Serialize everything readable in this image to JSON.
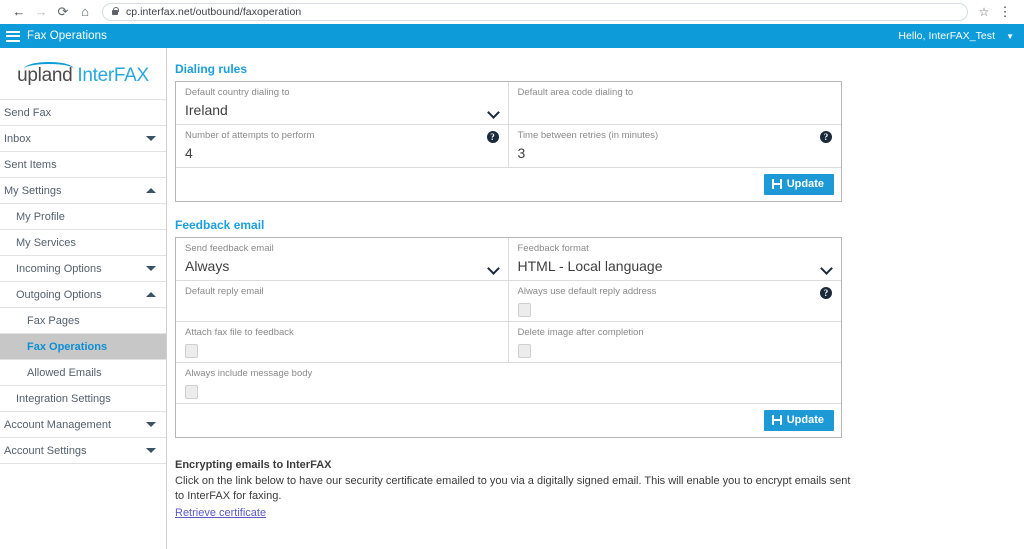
{
  "browser": {
    "back_icon": "back-arrow-icon",
    "forward_icon": "forward-arrow-icon",
    "reload_glyph": "⟳",
    "home_glyph": "⌂",
    "lock_icon": "lock-icon",
    "url": "cp.interfax.net/outbound/faxoperation",
    "star_glyph": "☆",
    "menu_glyph": "⋮"
  },
  "header": {
    "menu_icon": "hamburger-menu-icon",
    "title": "Fax Operations",
    "user_greeting": "Hello, InterFAX_Test",
    "caret_glyph": "▼"
  },
  "logo": {
    "upland": "upland",
    "interfax": "InterFAX"
  },
  "sidebar": {
    "items": [
      {
        "label": "Send Fax",
        "level": 1,
        "caret": "none",
        "active": false
      },
      {
        "label": "Inbox",
        "level": 1,
        "caret": "down",
        "active": false
      },
      {
        "label": "Sent Items",
        "level": 1,
        "caret": "none",
        "active": false
      },
      {
        "label": "My Settings",
        "level": 1,
        "caret": "up",
        "active": false
      },
      {
        "label": "My Profile",
        "level": 2,
        "caret": "none",
        "active": false
      },
      {
        "label": "My Services",
        "level": 2,
        "caret": "none",
        "active": false
      },
      {
        "label": "Incoming Options",
        "level": 2,
        "caret": "down",
        "active": false
      },
      {
        "label": "Outgoing Options",
        "level": 2,
        "caret": "up",
        "active": false
      },
      {
        "label": "Fax Pages",
        "level": 3,
        "caret": "none",
        "active": false
      },
      {
        "label": "Fax Operations",
        "level": 3,
        "caret": "none",
        "active": true
      },
      {
        "label": "Allowed Emails",
        "level": 3,
        "caret": "none",
        "active": false
      },
      {
        "label": "Integration Settings",
        "level": 2,
        "caret": "none",
        "active": false
      },
      {
        "label": "Account Management",
        "level": 1,
        "caret": "down",
        "active": false
      },
      {
        "label": "Account Settings",
        "level": 1,
        "caret": "down",
        "active": false
      }
    ]
  },
  "dialing_rules": {
    "title": "Dialing rules",
    "country_label": "Default country dialing to",
    "country_value": "Ireland",
    "area_code_label": "Default area code dialing to",
    "area_code_value": "",
    "attempts_label": "Number of attempts to perform",
    "attempts_value": "4",
    "retry_label": "Time between retries (in minutes)",
    "retry_value": "3",
    "update_label": "Update"
  },
  "feedback_email": {
    "title": "Feedback email",
    "send_label": "Send feedback email",
    "send_value": "Always",
    "format_label": "Feedback format",
    "format_value": "HTML - Local language",
    "reply_label": "Default reply email",
    "reply_value": "",
    "always_reply_label": "Always use default reply address",
    "attach_label": "Attach fax file to feedback",
    "delete_label": "Delete image after completion",
    "message_body_label": "Always include message body",
    "update_label": "Update"
  },
  "encrypting": {
    "title": "Encrypting emails to InterFAX",
    "body": "Click on the link below to have our security certificate emailed to you via a digitally signed email. This will enable you to encrypt emails sent to InterFAX for faxing.",
    "link": "Retrieve certificate"
  },
  "colors": {
    "brand_blue": "#0d9cd9",
    "section_title": "#1a9fdd",
    "button_blue": "#1d9ad6",
    "active_nav_bg": "#c7c7c7",
    "link_purple": "#5a58c8"
  }
}
